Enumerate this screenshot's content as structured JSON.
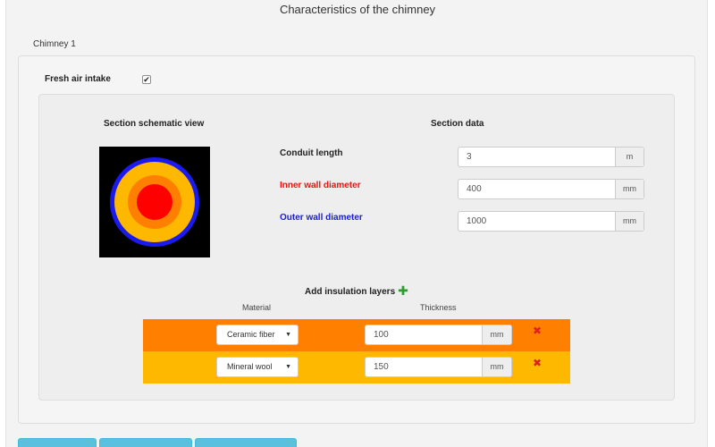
{
  "page": {
    "title": "Characteristics of the chimney"
  },
  "tabs": {
    "chimney_1": "Chimney 1"
  },
  "fresh_air": {
    "label": "Fresh air intake",
    "checked": true,
    "check_mark": "✔"
  },
  "section": {
    "schematic_heading": "Section schematic view",
    "data_heading": "Section data"
  },
  "fields": {
    "conduit_length": {
      "label": "Conduit length",
      "value": "3",
      "unit": "m",
      "color": "#222222"
    },
    "inner_wall_diameter": {
      "label": "Inner wall diameter",
      "value": "400",
      "unit": "mm",
      "color": "#ee1111"
    },
    "outer_wall_diameter": {
      "label": "Outer wall diameter",
      "value": "1000",
      "unit": "mm",
      "color": "#1a1ae6"
    }
  },
  "insulation": {
    "add_label": "Add insulation layers",
    "plus_glyph": "✚",
    "material_header": "Material",
    "thickness_header": "Thickness",
    "remove_glyph": "✖",
    "caret_glyph": "▼",
    "layers": [
      {
        "material": "Ceramic fiber",
        "thickness": "100",
        "unit": "mm",
        "color": "#ff7f00"
      },
      {
        "material": "Mineral wool",
        "thickness": "150",
        "unit": "mm",
        "color": "#ffb800"
      }
    ]
  },
  "schematic_colors": {
    "background": "#000000",
    "outer_wall": "#1a1aee",
    "mineral_wool": "#ffb800",
    "ceramic_fiber": "#ff7f00",
    "inner_conduit": "#ff0000"
  }
}
